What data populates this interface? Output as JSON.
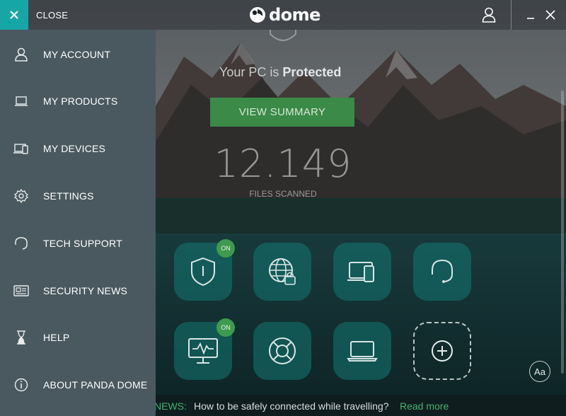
{
  "topbar": {
    "close_label": "CLOSE",
    "logo_text": "dome",
    "icons": [
      "close-icon",
      "panda-logo-icon",
      "user-icon",
      "minimize-icon",
      "window-close-icon"
    ]
  },
  "main": {
    "status_prefix": "Your PC is",
    "status_value": "Protected",
    "view_summary_label": "VIEW SUMMARY",
    "files_count": "12.149",
    "files_label": "FILES SCANNED",
    "tiles": [
      {
        "name": "antivirus",
        "icon": "shield-icon",
        "badge": "ON"
      },
      {
        "name": "web-protection",
        "icon": "globe-lock-icon",
        "badge": ""
      },
      {
        "name": "devices",
        "icon": "devices-icon",
        "badge": ""
      },
      {
        "name": "support",
        "icon": "headset-icon",
        "badge": ""
      },
      {
        "name": "monitor",
        "icon": "monitor-pulse-icon",
        "badge": "ON"
      },
      {
        "name": "rescue",
        "icon": "lifebuoy-icon",
        "badge": ""
      },
      {
        "name": "laptop",
        "icon": "laptop-icon",
        "badge": ""
      },
      {
        "name": "add",
        "icon": "plus-icon",
        "badge": ""
      }
    ],
    "font_size_button": "Aa"
  },
  "news": {
    "label": "NEWS:",
    "text": "How to be safely connected while travelling?",
    "link": "Read more"
  },
  "menu": {
    "items": [
      {
        "label": "MY ACCOUNT",
        "icon": "user-icon"
      },
      {
        "label": "MY PRODUCTS",
        "icon": "laptop-icon"
      },
      {
        "label": "MY DEVICES",
        "icon": "devices-icon"
      },
      {
        "label": "SETTINGS",
        "icon": "gear-icon"
      },
      {
        "label": "TECH SUPPORT",
        "icon": "headset-icon"
      },
      {
        "label": "SECURITY NEWS",
        "icon": "newspaper-icon"
      },
      {
        "label": "HELP",
        "icon": "hourglass-icon"
      },
      {
        "label": "ABOUT PANDA DOME",
        "icon": "info-icon"
      }
    ]
  },
  "colors": {
    "accent": "#17a6a6",
    "menu_bg": "#4a5960",
    "primary_button": "#3b8a47",
    "badge_on": "#3e9a4e",
    "news_highlight": "#3cb56e"
  }
}
